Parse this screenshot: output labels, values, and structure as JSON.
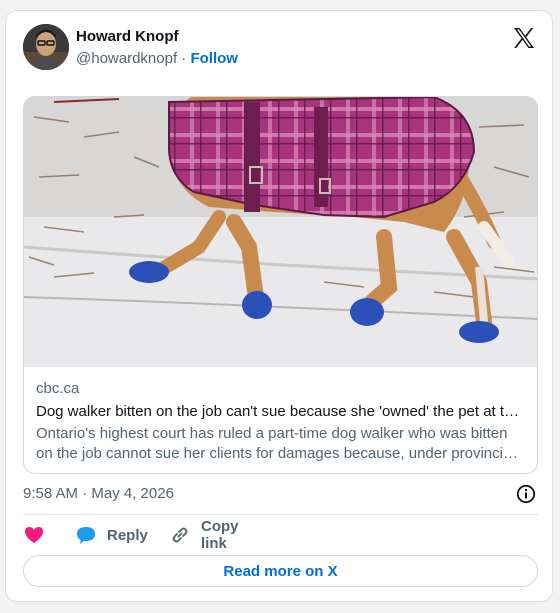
{
  "author": {
    "name": "Howard Knopf",
    "handle": "@howardknopf",
    "separator": "·",
    "follow_label": "Follow"
  },
  "link_card": {
    "domain": "cbc.ca",
    "title": "Dog walker bitten on the job can't sue because she 'owned' the pet at t…",
    "description": "Ontario's highest court has ruled a part-time dog walker who was bitten on the job cannot sue her clients for damages because, under provinci…"
  },
  "timestamp": "9:58 AM · May 4, 2026",
  "actions": {
    "reply_label": "Reply",
    "copy_link_label": "Copy link"
  },
  "read_more_label": "Read more on X",
  "colors": {
    "accent": "#006fd6",
    "like": "#f91880",
    "reply": "#1d9bf0",
    "muted_text": "#536471"
  },
  "icons": [
    "x-logo-icon",
    "info-icon",
    "heart-icon",
    "speech-bubble-icon",
    "link-icon"
  ]
}
